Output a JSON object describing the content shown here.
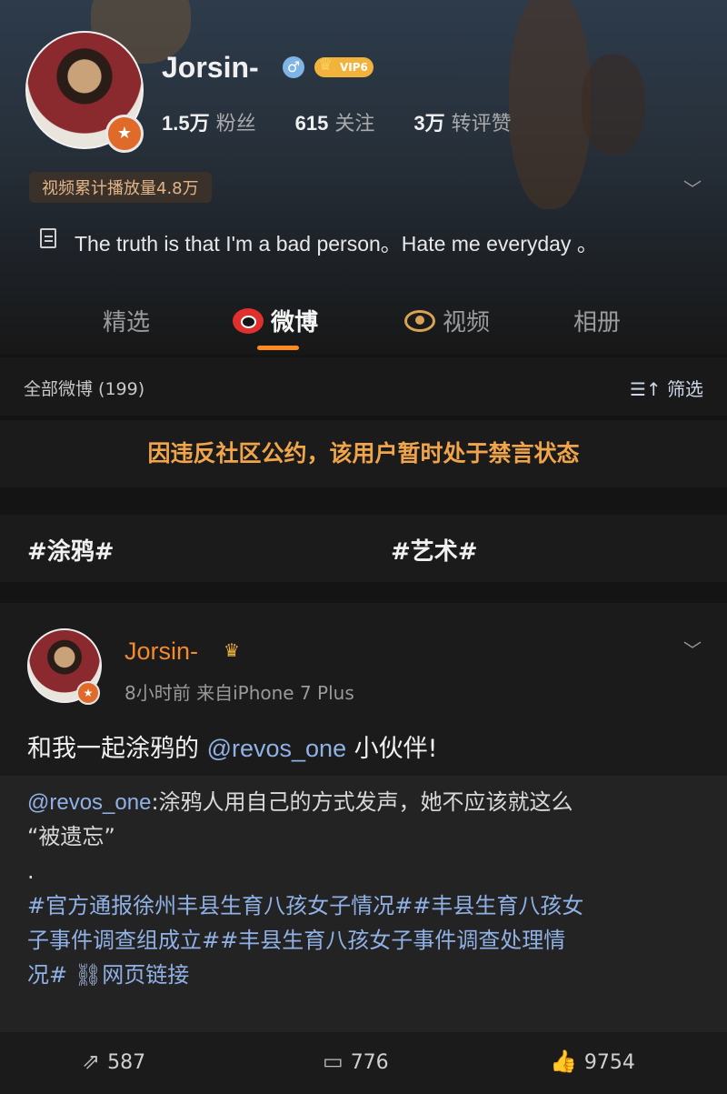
{
  "profile": {
    "name": "Jorsin-",
    "gender_symbol": "♂",
    "vip_label": "VIP6",
    "stats": [
      {
        "value": "1.5万",
        "label": "粉丝"
      },
      {
        "value": "615",
        "label": "关注"
      },
      {
        "value": "3万",
        "label": "转评赞"
      }
    ],
    "play_count": "视频累计播放量4.8万",
    "bio": "The truth is that I'm a bad person。Hate me everyday 。"
  },
  "tabs": [
    {
      "label": "精选"
    },
    {
      "label": "微博"
    },
    {
      "label": "视频"
    },
    {
      "label": "相册"
    }
  ],
  "filter_bar": {
    "count_label": "全部微博 (199)",
    "filter_label": "筛选",
    "filter_icon": "☰↑"
  },
  "notice": "因违反社区公约，该用户暂时处于禁言状态",
  "topics": [
    "#涂鸦#",
    "#艺术#"
  ],
  "post": {
    "author": "Jorsin-",
    "time": "8小时前",
    "source": "来自iPhone 7 Plus",
    "text_before": "和我一起涂鸦的 ",
    "mention": "@revos_one",
    "text_after": " 小伙伴!",
    "repost": {
      "author": "@revos_one",
      "line1": ":涂鸦人用自己的方式发声，她不应该就这么",
      "line2": "“被遗忘”",
      "line3": ".",
      "topics_line1": "#官方通报徐州丰县生育八孩女子情况##丰县生育八孩女",
      "topics_line2": "子事件调查组成立##丰县生育八孩女子事件调查处理情",
      "topics_line3": "况#",
      "link_label": "网页链接"
    },
    "actions": {
      "repost_count": "587",
      "comment_count": "776",
      "like_count": "9754"
    }
  }
}
